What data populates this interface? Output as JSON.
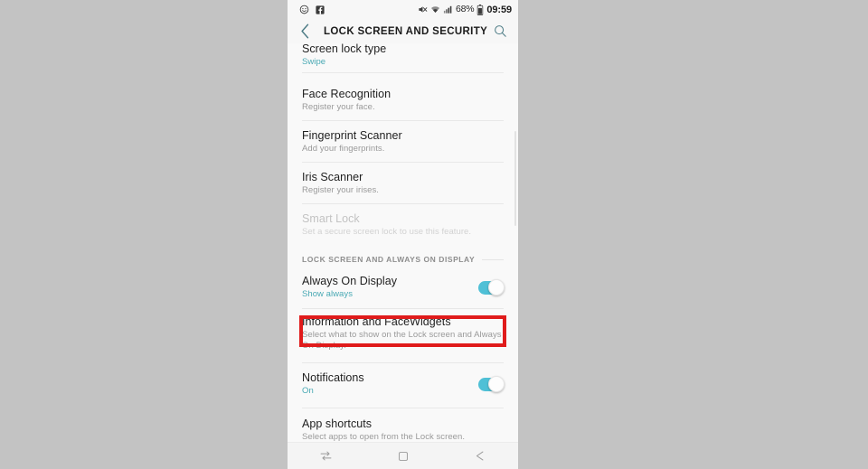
{
  "statusbar": {
    "left_icons": [
      {
        "name": "emoji-smiley-icon",
        "label": "Emoji notification"
      },
      {
        "name": "facebook-icon",
        "label": "Facebook"
      }
    ],
    "right_icons": [
      {
        "name": "mute-icon",
        "label": "Sound muted"
      },
      {
        "name": "wifi-icon",
        "label": "Wi-Fi"
      },
      {
        "name": "signal-bars-icon",
        "label": "Mobile signal"
      }
    ],
    "battery_percent": "68%",
    "battery_icon": "battery-icon",
    "time": "09:59"
  },
  "appbar": {
    "back_icon": "back-chevron-icon",
    "title": "LOCK SCREEN AND SECURITY",
    "search_icon": "search-icon"
  },
  "list": {
    "screen_lock_type": {
      "title": "Screen lock type",
      "subtitle": "Swipe"
    },
    "face_recognition": {
      "title": "Face Recognition",
      "subtitle": "Register your face."
    },
    "fingerprint_scanner": {
      "title": "Fingerprint Scanner",
      "subtitle": "Add your fingerprints."
    },
    "iris_scanner": {
      "title": "Iris Scanner",
      "subtitle": "Register your irises."
    },
    "smart_lock": {
      "title": "Smart Lock",
      "subtitle": "Set a secure screen lock to use this feature."
    },
    "section_header": "LOCK SCREEN AND ALWAYS ON DISPLAY",
    "always_on_display": {
      "title": "Always On Display",
      "subtitle": "Show always",
      "toggle": "on"
    },
    "information_facewidgets": {
      "title": "Information and FaceWidgets",
      "subtitle": "Select what to show on the Lock screen and Always On Display."
    },
    "notifications": {
      "title": "Notifications",
      "subtitle": "On",
      "toggle": "on"
    },
    "app_shortcuts": {
      "title": "App shortcuts",
      "subtitle": "Select apps to open from the Lock screen."
    }
  },
  "navbar": {
    "recents_icon": "recents-icon",
    "home_icon": "home-square-icon",
    "back_icon": "nav-back-arrow-icon"
  },
  "colors": {
    "accent": "#49a9b4",
    "toggle_on": "#4fc0d6",
    "highlight": "#e01b1b",
    "screen_bg": "#f9f9f9",
    "page_bg": "#c3c3c3"
  }
}
